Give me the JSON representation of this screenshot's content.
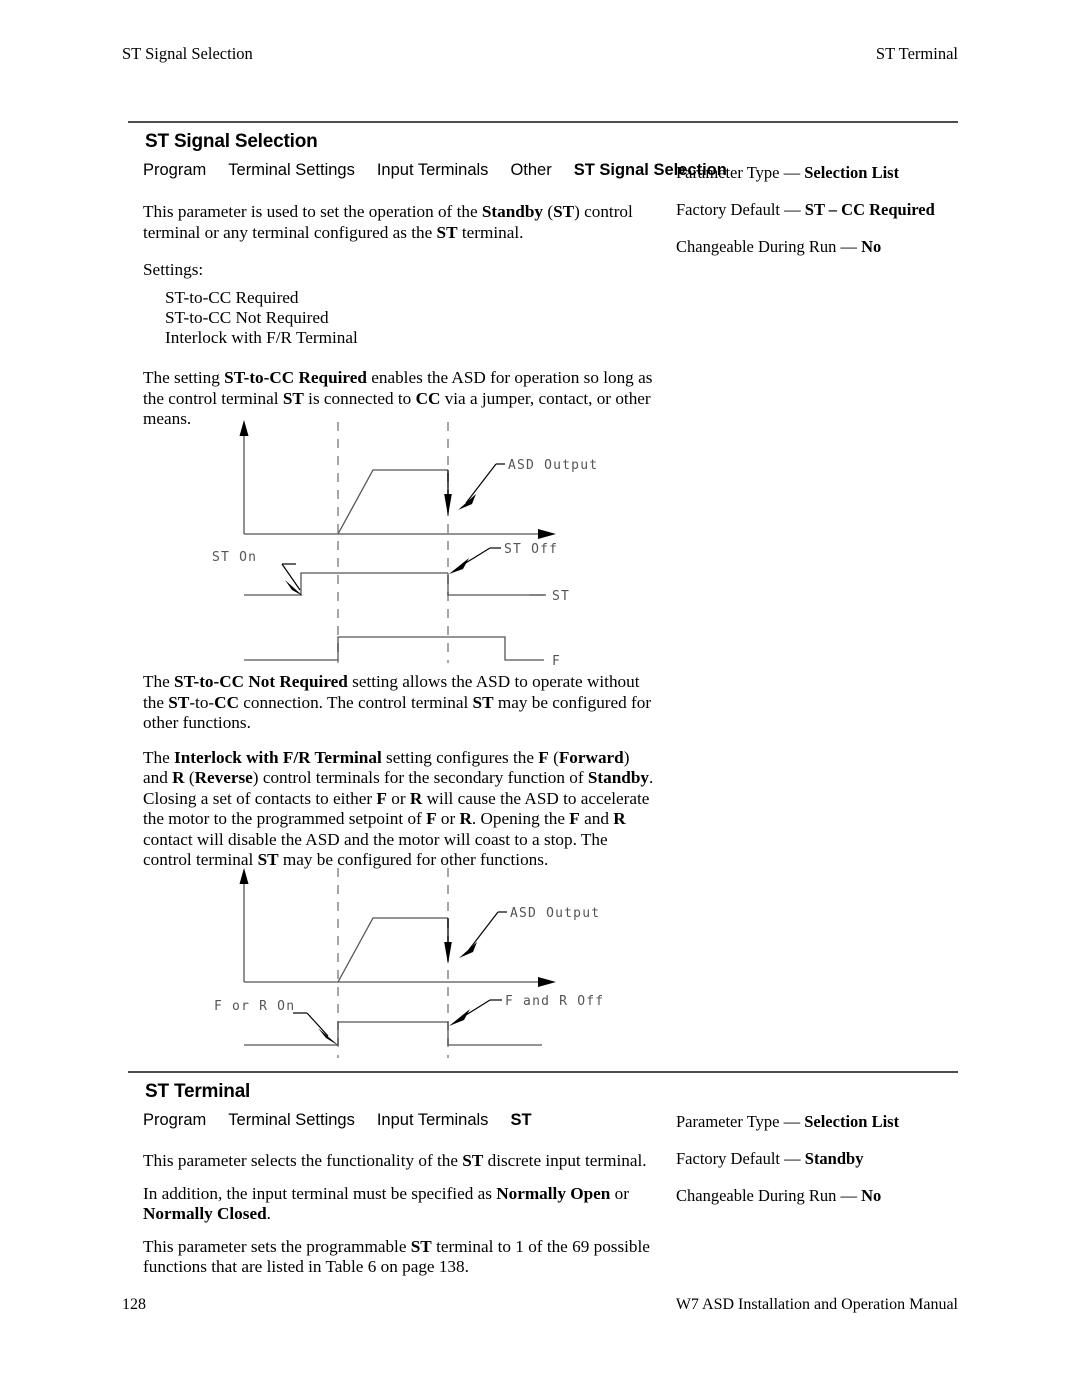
{
  "running_head": {
    "left": "ST Signal Selection",
    "right": "ST Terminal"
  },
  "sections": [
    {
      "heading": "ST Signal Selection",
      "breadcrumb": [
        "Program",
        "Terminal Settings",
        "Input Terminals",
        "Other",
        "ST Signal Selection"
      ],
      "intro_1": "This parameter is used to set the operation of the ",
      "intro_b1": "Standby",
      "intro_2": " (",
      "intro_b2": "ST",
      "intro_3": ") control terminal or any terminal configured as the ",
      "intro_b3": "ST",
      "intro_4": " terminal.",
      "settings_label": "Settings:",
      "settings": [
        "ST-to-CC Required",
        "ST-to-CC Not Required",
        "Interlock with F/R Terminal"
      ],
      "para_req_1": "The setting ",
      "para_req_b1": "ST-to-CC Required",
      "para_req_2": " enables the ASD for operation so long as the control terminal ",
      "para_req_b2": "ST",
      "para_req_3": " is connected to ",
      "para_req_b3": "CC",
      "para_req_4": " via a jumper, contact, or other means.",
      "specs": [
        {
          "label": "Parameter Type —",
          "value": "Selection List"
        },
        {
          "label": "Factory Default —",
          "value": "ST – CC Required"
        },
        {
          "label": "Changeable During Run —",
          "value": "No"
        }
      ]
    },
    {
      "heading": "ST Terminal",
      "breadcrumb": [
        "Program",
        "Terminal Settings",
        "Input Terminals",
        "ST"
      ],
      "para_1a": "This parameter selects the functionality of the ",
      "para_1b": "ST",
      "para_1c": " discrete input terminal.",
      "para_2a": "In addition, the input terminal must be specified as ",
      "para_2b": "Normally Open",
      "para_2c": " or ",
      "para_2d": "Normally Closed",
      "para_2e": ".",
      "para_3a": "This parameter sets the programmable ",
      "para_3b": "ST",
      "para_3c": " terminal to 1 of the 69 possible functions that are listed in Table 6 on page 138.",
      "specs": [
        {
          "label": "Parameter Type —",
          "value": "Selection List"
        },
        {
          "label": "Factory Default —",
          "value": "Standby"
        },
        {
          "label": "Changeable During Run —",
          "value": "No"
        }
      ]
    }
  ],
  "paragraphs_middle": {
    "notreq_1": "The ",
    "notreq_b1": "ST-to-CC Not Required",
    "notreq_2": " setting allows the ASD to operate without the ",
    "notreq_b2": "ST",
    "notreq_3": "-to-",
    "notreq_b3": "CC",
    "notreq_4": " connection. The control terminal ",
    "notreq_b4": "ST",
    "notreq_5": " may be configured for other functions.",
    "interlock_1": "The ",
    "interlock_b1": "Interlock with F/R Terminal",
    "interlock_2": " setting configures the ",
    "interlock_b2": "F",
    "interlock_3": " (",
    "interlock_b3": "Forward",
    "interlock_4": ") and ",
    "interlock_b4": "R",
    "interlock_5": " (",
    "interlock_b5": "Reverse",
    "interlock_6": ") control terminals for the secondary function of ",
    "interlock_b6": "Standby",
    "interlock_7": ". Closing a set of contacts to either ",
    "interlock_b7": "F",
    "interlock_8": " or ",
    "interlock_b8": "R",
    "interlock_9": " will cause the ASD to accelerate the motor to the programmed setpoint of ",
    "interlock_b9": "F",
    "interlock_10": " or ",
    "interlock_b10": "R",
    "interlock_11": ". Opening the ",
    "interlock_b11": "F",
    "interlock_12": " and ",
    "interlock_b12": "R",
    "interlock_13": " contact will disable the ASD and the motor will coast to a stop. The control terminal ",
    "interlock_b13": "ST",
    "interlock_14": " may be configured for other functions."
  },
  "diagram_1": {
    "labels": {
      "asd_output": "ASD Output",
      "st_on": "ST On",
      "st_off": "ST Off",
      "st": "ST",
      "f": "F"
    }
  },
  "diagram_2": {
    "labels": {
      "asd_output": "ASD Output",
      "f_or_r_on": "F or R On",
      "f_and_r_off": "F and R Off"
    }
  },
  "footer": {
    "page_number": "128",
    "manual_title": "W7 ASD Installation and Operation Manual"
  },
  "colors": {
    "rule": "#4d4d4d",
    "waveform": "#555555",
    "dashed": "#a6a6a6",
    "text": "#000000"
  }
}
